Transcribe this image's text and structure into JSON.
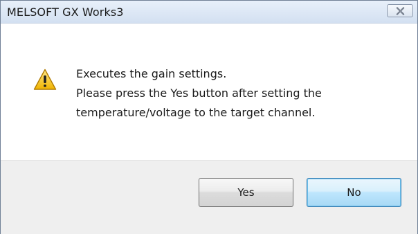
{
  "window": {
    "title": "MELSOFT GX Works3",
    "close_icon": "close-icon"
  },
  "message": {
    "icon": "warning-icon",
    "lines": [
      "Executes the gain settings.",
      "Please press the Yes button after setting the",
      "temperature/voltage to the target channel."
    ]
  },
  "buttons": {
    "yes_label": "Yes",
    "no_label": "No"
  }
}
